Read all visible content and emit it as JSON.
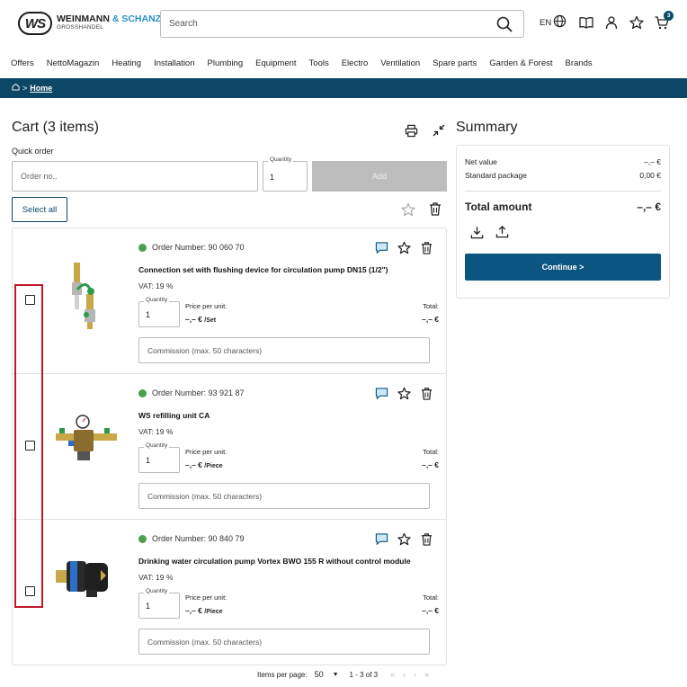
{
  "header": {
    "logo_mark": "WS",
    "logo_line1_a": "WEINMANN",
    "logo_line1_b": "& SCHANZ",
    "logo_line2": "GROSSHANDEL",
    "search_placeholder": "Search",
    "language": "EN",
    "cart_count": "3"
  },
  "nav": [
    "Offers",
    "NettoMagazin",
    "Heating",
    "Installation",
    "Plumbing",
    "Equipment",
    "Tools",
    "Electro",
    "Ventilation",
    "Spare parts",
    "Garden & Forest",
    "Brands"
  ],
  "breadcrumb": {
    "separator": ">",
    "home": "Home"
  },
  "cart": {
    "title": "Cart (3 items)",
    "quick_order_label": "Quick order",
    "order_placeholder": "Order no..",
    "quantity_label": "Quantity",
    "quantity_value": "1",
    "add_label": "Add",
    "select_all_label": "Select all",
    "items": [
      {
        "order_number": "Order Number: 90 060 70",
        "name": "Connection set with flushing device for circulation pump DN15 (1/2\")",
        "vat": "VAT: 19 %",
        "quantity_label": "Quantity",
        "quantity": "1",
        "price_label": "Price per unit:",
        "price": "–,– €",
        "unit": "/Set",
        "total_label": "Total:",
        "total": "–,– €",
        "commission_placeholder": "Commission (max. 50 characters)"
      },
      {
        "order_number": "Order Number: 93 921 87",
        "name": "WS refilling unit CA",
        "vat": "VAT: 19 %",
        "quantity_label": "Quantity",
        "quantity": "1",
        "price_label": "Price per unit:",
        "price": "–,– €",
        "unit": "/Piece",
        "total_label": "Total:",
        "total": "–,– €",
        "commission_placeholder": "Commission (max. 50 characters)"
      },
      {
        "order_number": "Order Number: 90 840 79",
        "name": "Drinking water circulation pump Vortex BWO 155 R without control module",
        "vat": "VAT: 19 %",
        "quantity_label": "Quantity",
        "quantity": "1",
        "price_label": "Price per unit:",
        "price": "–,– €",
        "unit": "/Piece",
        "total_label": "Total:",
        "total": "–,– €",
        "commission_placeholder": "Commission (max. 50 characters)"
      }
    ]
  },
  "pagination": {
    "items_per_page_label": "Items per page:",
    "items_per_page": "50",
    "range": "1 - 3 of 3"
  },
  "summary": {
    "title": "Summary",
    "net_value_label": "Net value",
    "net_value": "–,– €",
    "standard_package_label": "Standard package",
    "standard_package": "0,00 €",
    "total_label": "Total amount",
    "total": "–,– €",
    "continue_label": "Continue >"
  },
  "colors": {
    "brand": "#0c4766",
    "accent": "#2a8fc9",
    "status_green": "#4aa04f",
    "highlight": "#c0182a"
  },
  "icons": [
    "search-icon",
    "globe-icon",
    "catalog-icon",
    "user-icon",
    "star-icon",
    "cart-icon",
    "home-icon",
    "print-icon",
    "collapse-icon",
    "trash-icon",
    "comment-icon",
    "download-icon",
    "upload-icon"
  ]
}
